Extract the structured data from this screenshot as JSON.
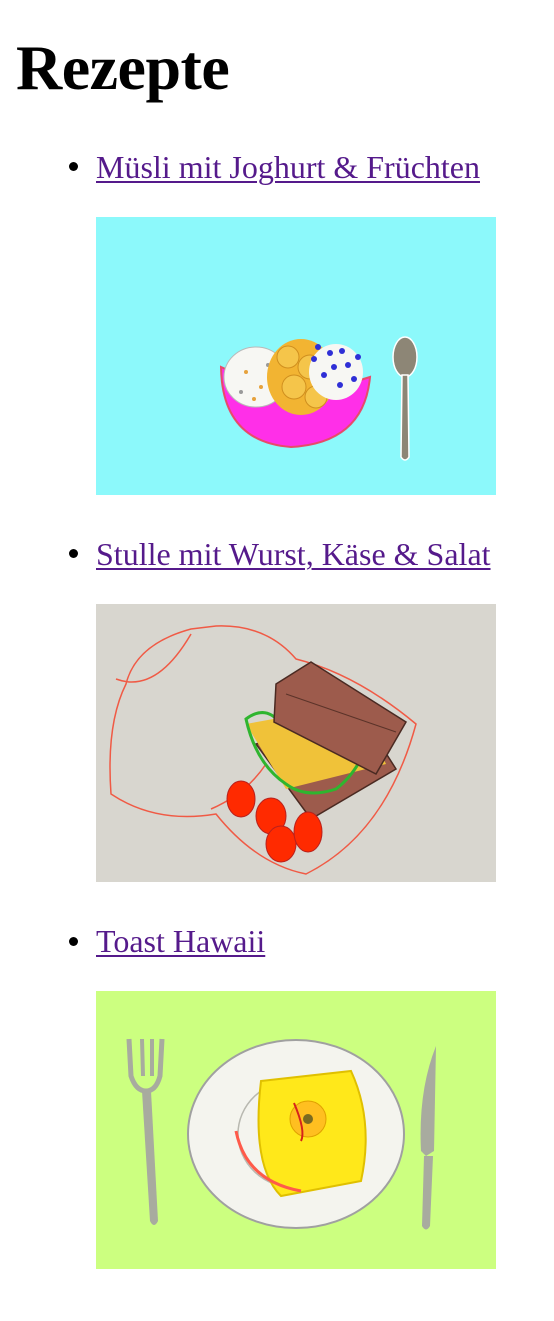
{
  "page": {
    "title": "Rezepte"
  },
  "recipes": [
    {
      "label": "Müsli mit Joghurt & Früchten",
      "image": "muesli-bowl-with-spoon-illustration",
      "bg": "#8cf9fb"
    },
    {
      "label": "Stulle mit Wurst, Käse & Salat",
      "image": "sandwich-in-lunchbox-with-tomatoes-illustration",
      "bg": "#d8d6cf"
    },
    {
      "label": "Toast Hawaii",
      "image": "toast-hawaii-on-plate-with-cutlery-illustration",
      "bg": "#ccff80"
    }
  ],
  "colors": {
    "link_visited": "#551a8b"
  }
}
